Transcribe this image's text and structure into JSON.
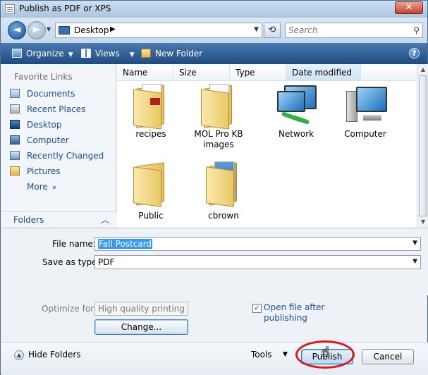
{
  "window": {
    "title": "Publish as PDF or XPS",
    "close_glyph": "✕"
  },
  "address": {
    "location": "Desktop",
    "search_placeholder": "Search"
  },
  "toolbar": {
    "organize": "Organize",
    "views": "Views",
    "new_folder": "New Folder"
  },
  "sidebar": {
    "header": "Favorite Links",
    "items": [
      {
        "label": "Documents"
      },
      {
        "label": "Recent Places"
      },
      {
        "label": "Desktop"
      },
      {
        "label": "Computer"
      },
      {
        "label": "Recently Changed"
      },
      {
        "label": "Pictures"
      },
      {
        "label": "More"
      }
    ],
    "folders_label": "Folders"
  },
  "file_list": {
    "columns": [
      "Name",
      "Size",
      "Type",
      "Date modified"
    ],
    "items": [
      {
        "name": "recipes",
        "icon": "folder-icon"
      },
      {
        "name": "MOL Pro KB images",
        "icon": "folder-icon"
      },
      {
        "name": "Network",
        "icon": "network-icon"
      },
      {
        "name": "Computer",
        "icon": "computer-icon"
      },
      {
        "name": "Public",
        "icon": "folder-icon"
      },
      {
        "name": "cbrown",
        "icon": "user-folder-icon"
      }
    ]
  },
  "form": {
    "file_name_label": "File name:",
    "file_name_value": "Fall Postcard",
    "save_type_label": "Save as type:",
    "save_type_value": "PDF",
    "optimize_label": "Optimize for:",
    "optimize_value": "High quality printing",
    "change_button": "Change...",
    "open_after_label": "Open file after publishing",
    "open_after_checked": true
  },
  "bottom": {
    "hide_folders": "Hide Folders",
    "tools": "Tools",
    "publish": "Publish",
    "cancel": "Cancel"
  },
  "colors": {
    "toolbar": "#1d4a82",
    "link": "#1a4fa0",
    "selection": "#3399ff",
    "highlight_ring": "#e11818"
  }
}
